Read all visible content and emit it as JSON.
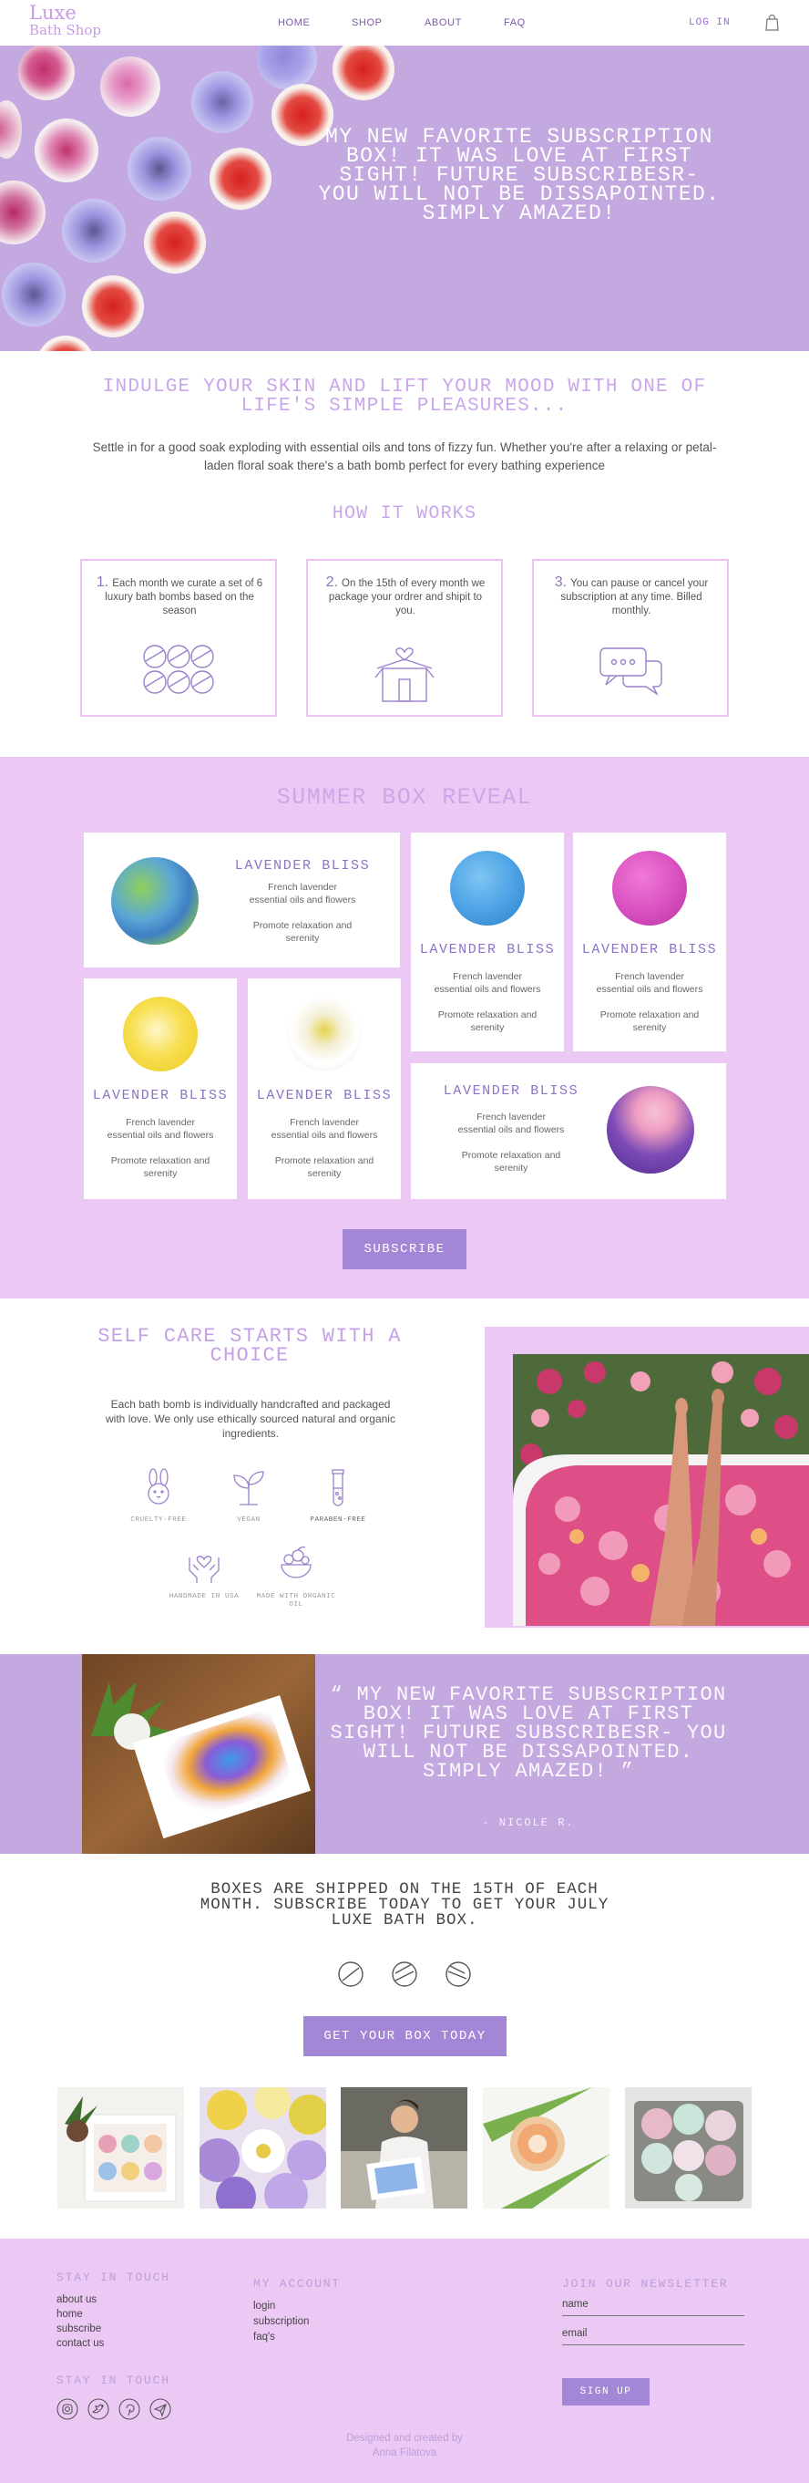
{
  "nav": {
    "logo_line1": "Luxe",
    "logo_line2": "Bath Shop",
    "links": [
      "HOME",
      "SHOP",
      "ABOUT",
      "FAQ"
    ],
    "login": "LOG IN",
    "cart_icon": "shopping-bag-icon"
  },
  "hero": {
    "quote": "MY NEW FAVORITE SUBSCRIPTION BOX! IT WAS LOVE AT FIRST SIGHT! FUTURE SUBSCRIBESR- YOU WILL NOT BE DISSAPOINTED. SIMPLY AMAZED!"
  },
  "indulge": {
    "heading": "INDULGE YOUR SKIN AND LIFT YOUR MOOD WITH ONE OF LIFE'S SIMPLE PLEASURES...",
    "body": "Settle in for a good soak exploding with essential oils and tons of fizzy fun. Whether you're after a relaxing or petal-laden floral soak there's a bath bomb perfect for every bathing experience"
  },
  "how": {
    "heading": "HOW IT WORKS",
    "steps": [
      {
        "num": "1.",
        "text": "Each month we curate a set of 6 luxury bath bombs based on the season",
        "icon": "bath-bombs-icon"
      },
      {
        "num": "2.",
        "text": "On the 15th of every month we package your ordrer and shipit to you.",
        "icon": "gift-box-icon"
      },
      {
        "num": "3.",
        "text": "You can pause or cancel your subscription at any time. Billed monthly.",
        "icon": "chat-bubbles-icon"
      }
    ]
  },
  "summer": {
    "heading": "SUMMER BOX REVEAL",
    "cards": [
      {
        "title": "LAVENDER BLISS",
        "line1": "French lavender",
        "line2": "essential oils and flowers",
        "line3": "Promote relaxation and",
        "line4": "serenity"
      },
      {
        "title": "LAVENDER BLISS",
        "line1": "French lavender",
        "line2": "essential oils and flowers",
        "line3": "Promote relaxation and",
        "line4": "serenity"
      },
      {
        "title": "LAVENDER BLISS",
        "line1": "French lavender",
        "line2": "essential oils and flowers",
        "line3": "Promote relaxation and",
        "line4": "serenity"
      },
      {
        "title": "LAVENDER BLISS",
        "line1": "French lavender",
        "line2": "essential oils and flowers",
        "line3": "Promote relaxation and",
        "line4": "serenity"
      },
      {
        "title": "LAVENDER BLISS",
        "line1": "French lavender",
        "line2": "essential oils and flowers",
        "line3": "Promote relaxation and",
        "line4": "serenity"
      },
      {
        "title": "LAVENDER BLISS",
        "line1": "French lavender",
        "line2": "essential oils and flowers",
        "line3": "Promote relaxation and",
        "line4": "serenity"
      }
    ],
    "button": "SUBSCRIBE"
  },
  "selfcare": {
    "heading": "SELF CARE STARTS WITH A CHOICE",
    "body": "Each bath bomb is individually handcrafted and packaged with love. We only use ethically sourced natural and organic ingredients.",
    "features": [
      {
        "label": "CRUELTY-FREE",
        "icon": "bunny-icon"
      },
      {
        "label": "VEGAN",
        "icon": "sprout-icon"
      },
      {
        "label": "PARABEN-FREE",
        "icon": "test-tube-icon"
      },
      {
        "label": "HANDMADE IN USA",
        "icon": "hands-heart-icon"
      },
      {
        "label": "MADE WITH ORGANIC OIL",
        "icon": "organic-bowl-icon"
      }
    ]
  },
  "testimonial": {
    "quote": "“ MY NEW FAVORITE SUBSCRIPTION BOX! IT WAS LOVE AT FIRST SIGHT! FUTURE SUBSCRIBESR- YOU WILL NOT BE DISSAPOINTED. SIMPLY AMAZED! ”",
    "author": "- NICOLE R."
  },
  "shipping": {
    "text": "BOXES ARE SHIPPED ON THE 15TH OF EACH MONTH. SUBSCRIBE TODAY TO GET YOUR JULY LUXE BATH BOX.",
    "button": "GET YOUR BOX TODAY"
  },
  "footer": {
    "stay_heading": "STAY IN TOUCH",
    "stay_links": [
      "about us",
      "home",
      "subscribe",
      "contact us"
    ],
    "social_heading": "STAY IN TOUCH",
    "social_icons": [
      "instagram-icon",
      "twitter-icon",
      "pinterest-icon",
      "send-icon"
    ],
    "account_heading": "MY ACCOUNT",
    "account_links": [
      "login",
      "subscription",
      "faq's"
    ],
    "newsletter_heading": "JOIN OUR NEWSLETTER",
    "name_placeholder": "name",
    "email_placeholder": "email",
    "signup": "SIGN UP",
    "credit_line1": "Designed and created by",
    "credit_line2": "Anna Filatova"
  },
  "colors": {
    "lavender": "#c4a9e0",
    "pink": "#ecc8f4",
    "button": "#a386d5",
    "heading_text": "#c9a6ea"
  }
}
